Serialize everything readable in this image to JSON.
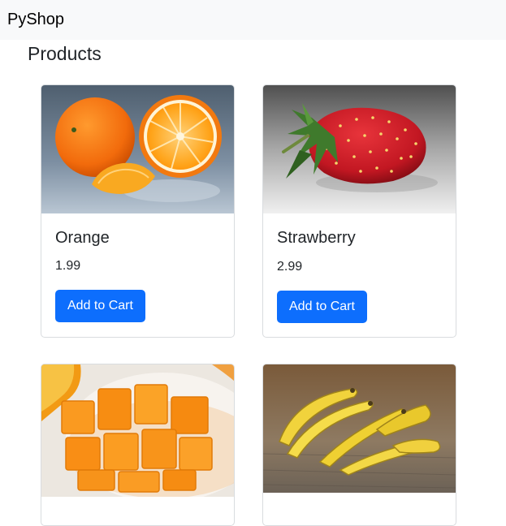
{
  "navbar": {
    "brand": "PyShop"
  },
  "page": {
    "title": "Products"
  },
  "products": [
    {
      "name": "Orange",
      "price": "1.99",
      "button_label": "Add to Cart",
      "image_icon": "orange-image"
    },
    {
      "name": "Strawberry",
      "price": "2.99",
      "button_label": "Add to Cart",
      "image_icon": "strawberry-image"
    },
    {
      "name": "",
      "price": "",
      "button_label": "",
      "image_icon": "mango-image"
    },
    {
      "name": "",
      "price": "",
      "button_label": "",
      "image_icon": "banana-image"
    }
  ],
  "colors": {
    "navbar_bg": "#f8f9fa",
    "button_primary": "#0d6efd",
    "card_border": "#d9dcdf"
  }
}
